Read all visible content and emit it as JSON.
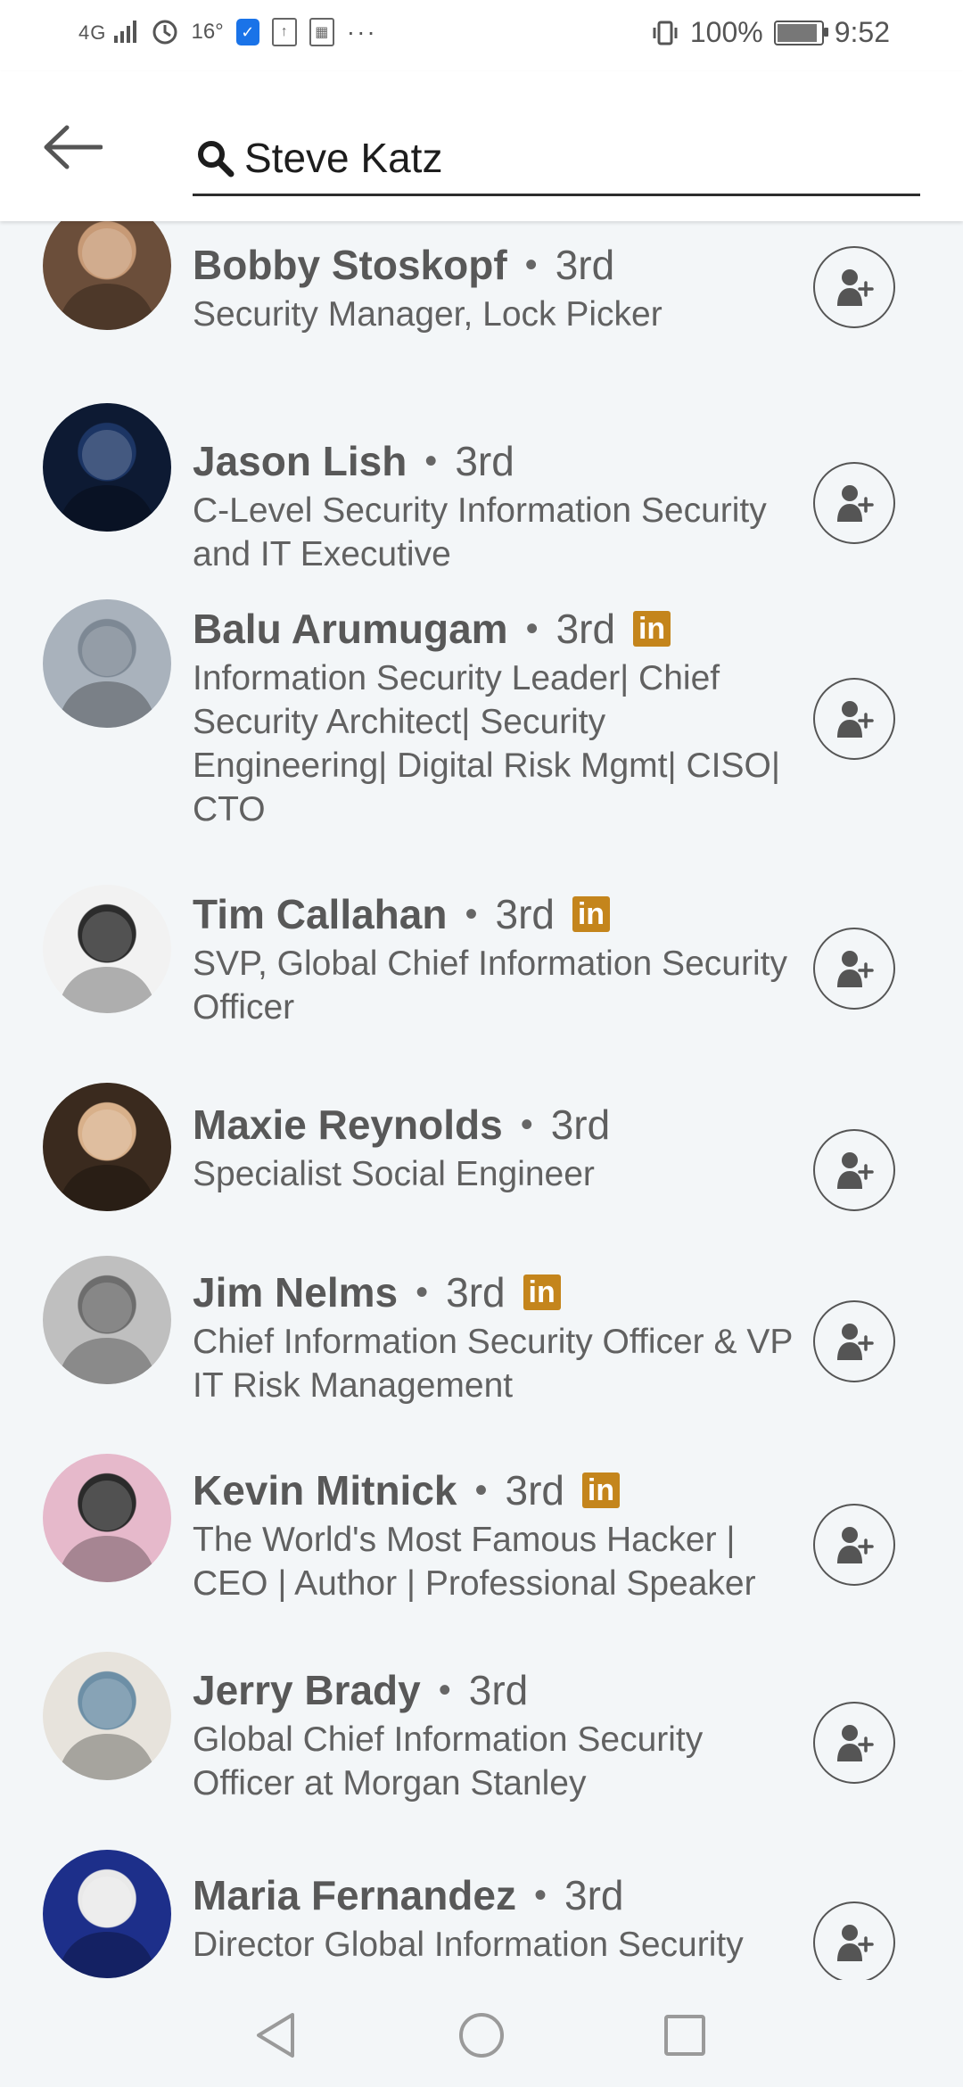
{
  "status_bar": {
    "network": "4G",
    "temperature": "16°",
    "battery_percent": "100%",
    "time": "9:52"
  },
  "search": {
    "query": "Steve Katz"
  },
  "results": [
    {
      "name": "Bobby Stoskopf",
      "degree": "3rd",
      "headline": "Security Manager, Lock Picker",
      "premium": false,
      "avatar_colors": [
        "#6b4e3a",
        "#c79a76"
      ]
    },
    {
      "name": "Jason Lish",
      "degree": "3rd",
      "headline": "C-Level Security Information Security and IT Executive",
      "premium": false,
      "avatar_colors": [
        "#0d1a33",
        "#1c3564"
      ]
    },
    {
      "name": "Balu Arumugam",
      "degree": "3rd",
      "headline": "Information Security Leader| Chief Security Architect| Security Engineering| Digital Risk Mgmt| CISO| CTO",
      "premium": true,
      "avatar_colors": [
        "#a9b2bc",
        "#7d8894"
      ]
    },
    {
      "name": "Tim Callahan",
      "degree": "3rd",
      "headline": "SVP, Global Chief Information Security Officer",
      "premium": true,
      "avatar_colors": [
        "#f2f2f2",
        "#2c2c2c"
      ]
    },
    {
      "name": "Maxie Reynolds",
      "degree": "3rd",
      "headline": "Specialist Social Engineer",
      "premium": false,
      "avatar_colors": [
        "#3a2a1e",
        "#d8b08a"
      ]
    },
    {
      "name": "Jim Nelms",
      "degree": "3rd",
      "headline": "Chief Information Security Officer & VP IT Risk Management",
      "premium": true,
      "avatar_colors": [
        "#bfbfbf",
        "#6d6d6d"
      ]
    },
    {
      "name": "Kevin Mitnick",
      "degree": "3rd",
      "headline": "The World's Most Famous Hacker | CEO | Author | Professional Speaker",
      "premium": true,
      "avatar_colors": [
        "#e6b9cb",
        "#2b2b2b"
      ]
    },
    {
      "name": "Jerry Brady",
      "degree": "3rd",
      "headline": "Global Chief Information Security Officer at Morgan Stanley",
      "premium": false,
      "avatar_colors": [
        "#e7e3dc",
        "#6d8fa6"
      ]
    },
    {
      "name": "Maria Fernandez",
      "degree": "3rd",
      "headline": "Director Global Information Security",
      "premium": false,
      "avatar_colors": [
        "#1d2f8a",
        "#e9e9e9"
      ]
    }
  ],
  "colors": {
    "premium_badge": "#c4851c",
    "background": "#f3f6f8"
  }
}
